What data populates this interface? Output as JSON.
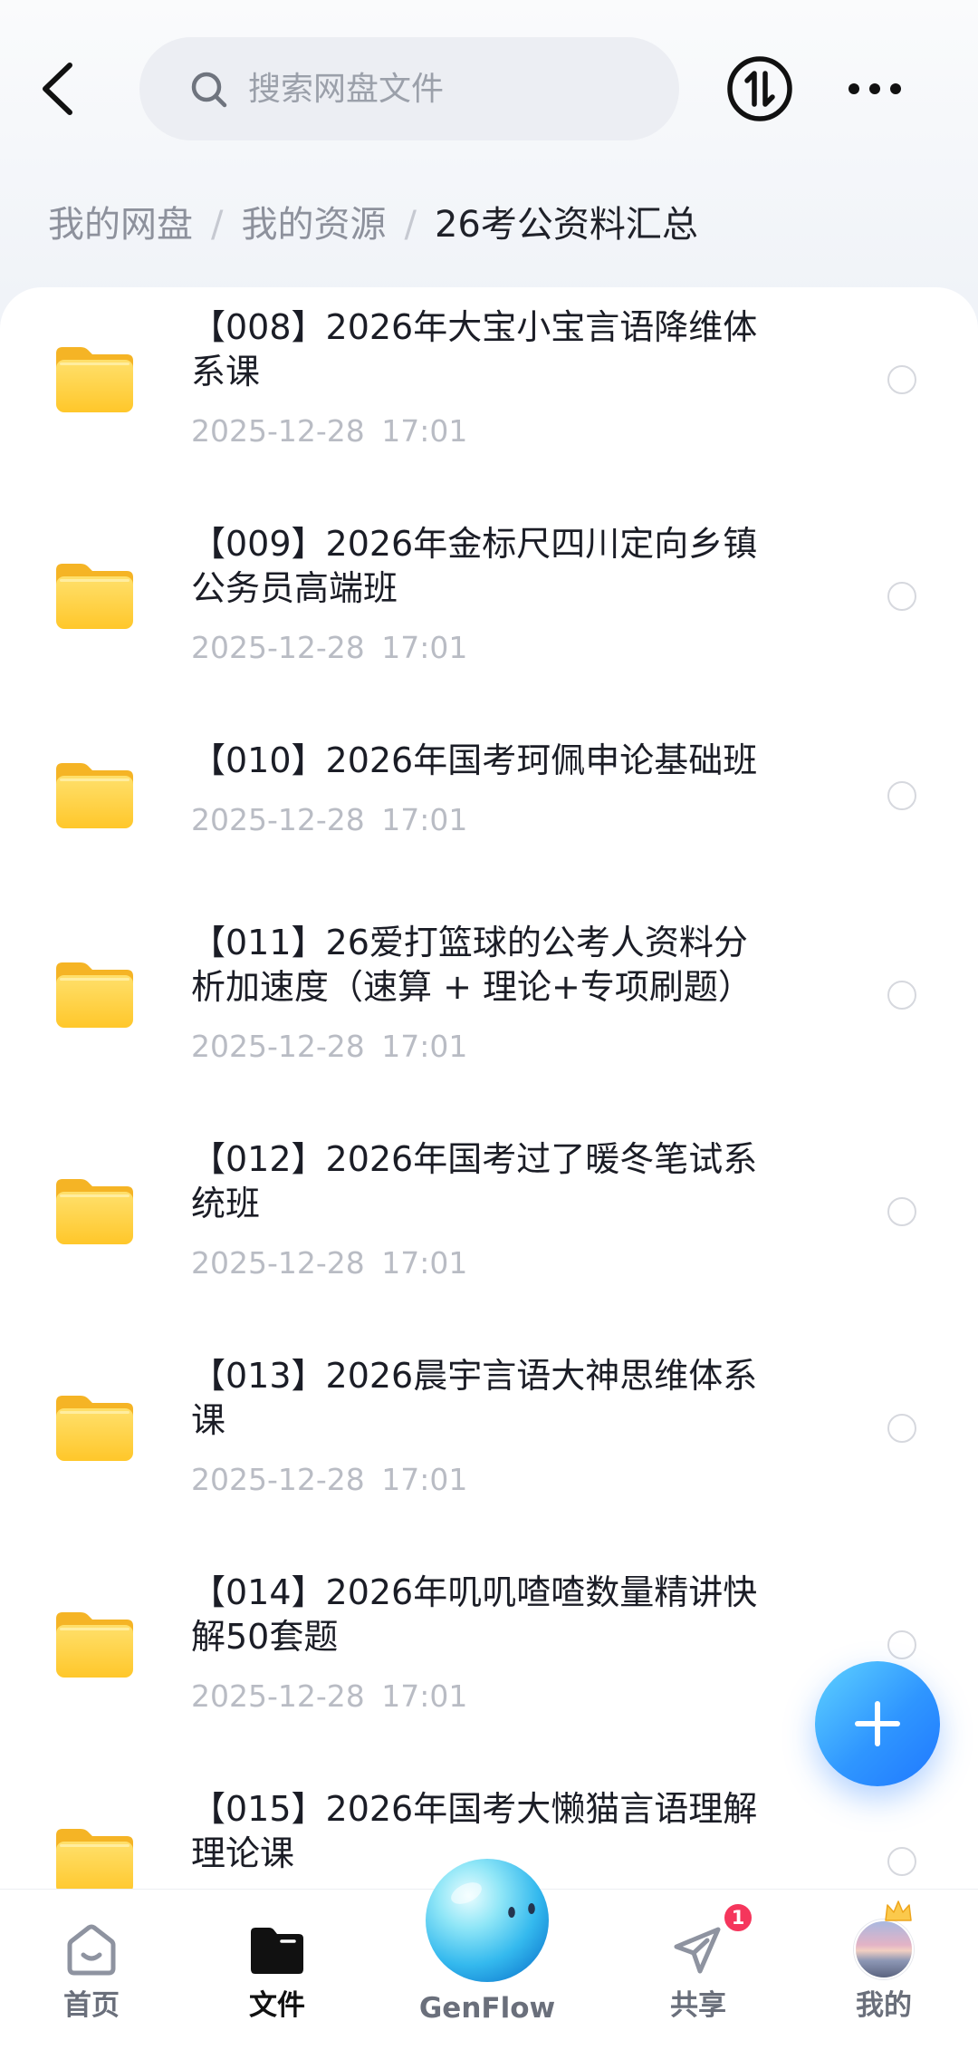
{
  "header": {
    "search_placeholder": "搜索网盘文件",
    "icons": [
      "back-arrow-icon",
      "search-icon",
      "transfer-icon",
      "more-icon"
    ]
  },
  "breadcrumb": {
    "items": [
      {
        "label": "我的网盘"
      },
      {
        "label": "我的资源"
      },
      {
        "label": "26考公资料汇总"
      }
    ],
    "separator": "/"
  },
  "files": [
    {
      "title_lines": [
        "【008】2026年大宝小宝言语降维体",
        "系课"
      ],
      "modified": "2025-12-28 17:01"
    },
    {
      "title_lines": [
        "【009】2026年金标尺四川定向乡镇",
        "公务员高端班"
      ],
      "modified": "2025-12-28 17:01"
    },
    {
      "title_lines": [
        "【010】2026年国考珂佩申论基础班"
      ],
      "modified": "2025-12-28 17:01"
    },
    {
      "title_lines": [
        "【011】26爱打篮球的公考人资料分",
        "析加速度（速算 + 理论+专项刷题）"
      ],
      "modified": "2025-12-28 17:01"
    },
    {
      "title_lines": [
        "【012】2026年国考过了暖冬笔试系",
        "统班"
      ],
      "modified": "2025-12-28 17:01"
    },
    {
      "title_lines": [
        "【013】2026晨宇言语大神思维体系",
        "课"
      ],
      "modified": "2025-12-28 17:01"
    },
    {
      "title_lines": [
        "【014】2026年叽叽喳喳数量精讲快",
        "解50套题"
      ],
      "modified": "2025-12-28 17:01"
    },
    {
      "title_lines": [
        "【015】2026年国考大懒猫言语理解",
        "理论课"
      ]
    }
  ],
  "fab": {
    "icon": "plus-icon"
  },
  "nav": {
    "items": [
      {
        "label": "首页",
        "icon": "home-icon",
        "active": false
      },
      {
        "label": "文件",
        "icon": "folder-icon",
        "active": true
      },
      {
        "label": "GenFlow",
        "icon": "genflow-orb-icon",
        "active": false
      },
      {
        "label": "共享",
        "icon": "paper-plane-icon",
        "active": false,
        "badge": "1"
      },
      {
        "label": "我的",
        "icon": "avatar",
        "active": false
      }
    ]
  },
  "colors": {
    "accent": "#2f96ff",
    "folder": "#ffcf33",
    "badge": "#f5365c",
    "text_primary": "#1b1d26",
    "text_secondary": "#b9bcc4"
  }
}
